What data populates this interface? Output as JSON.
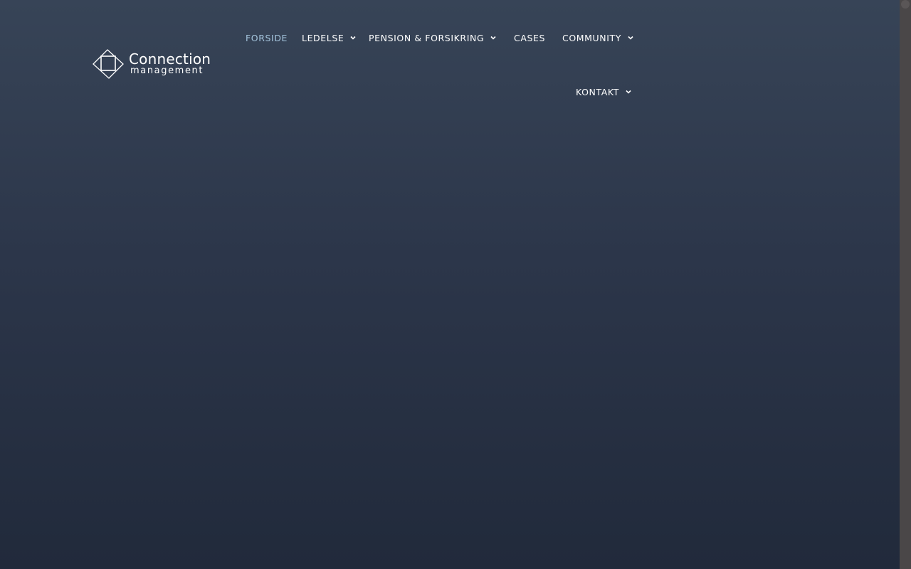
{
  "brand": {
    "name": "Connection",
    "sub": "management",
    "logo_icon": "overlapping-squares-logo"
  },
  "nav": {
    "items": [
      {
        "label": "FORSIDE",
        "active": true,
        "has_dropdown": false
      },
      {
        "label": "LEDELSE",
        "active": false,
        "has_dropdown": true
      },
      {
        "label": "PENSION & FORSIKRING",
        "active": false,
        "has_dropdown": true
      },
      {
        "label": "CASES",
        "active": false,
        "has_dropdown": false
      },
      {
        "label": "COMMUNITY",
        "active": false,
        "has_dropdown": true
      },
      {
        "label": "KONTAKT",
        "active": false,
        "has_dropdown": true
      }
    ],
    "dropdown_icon": "chevron-down-icon"
  },
  "colors": {
    "background_top": "#374457",
    "background_bottom": "#212a3b",
    "nav_text": "#ffffff",
    "nav_active": "#a6c6de"
  }
}
